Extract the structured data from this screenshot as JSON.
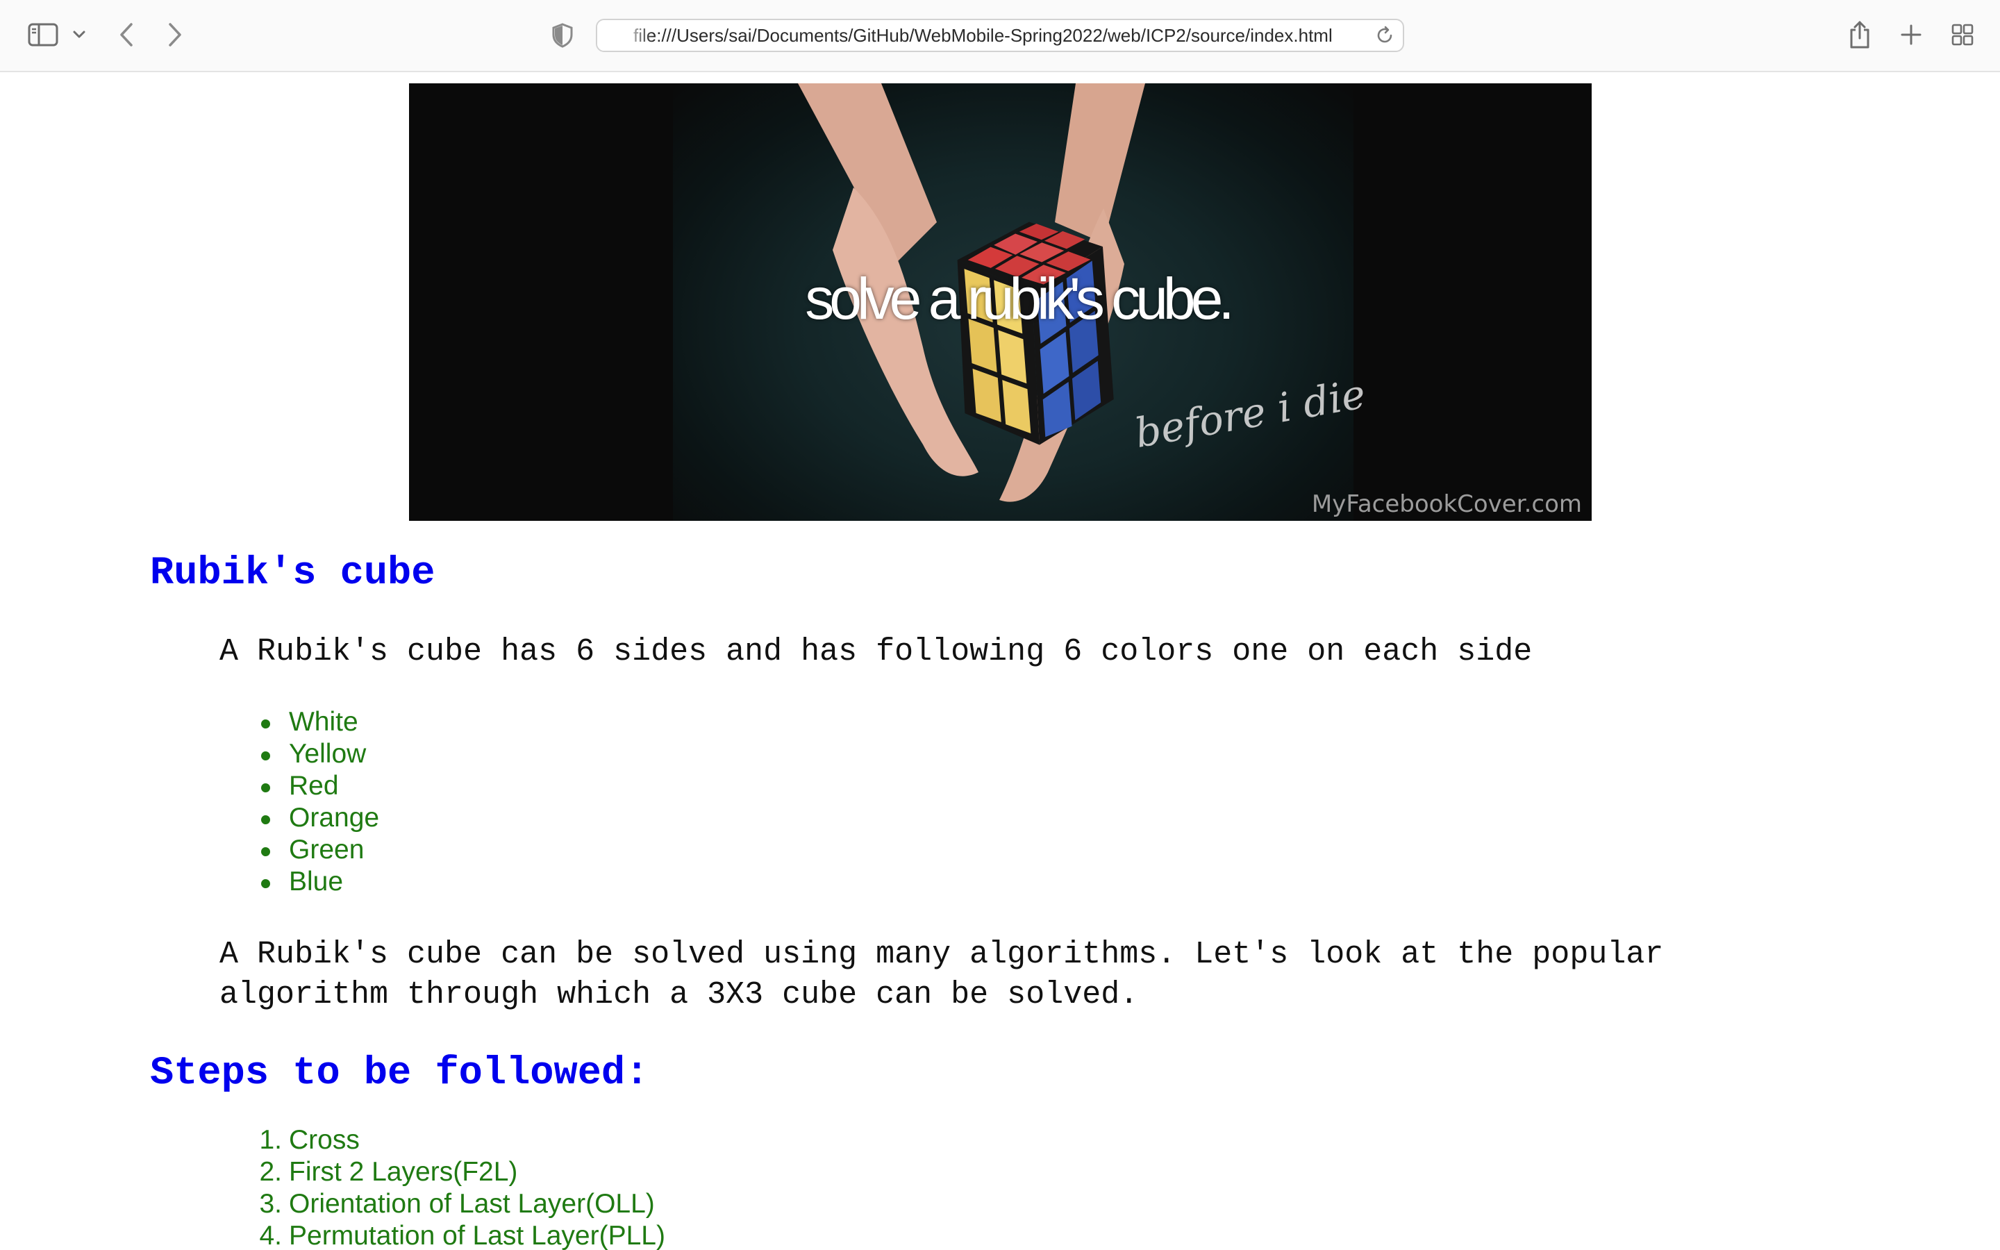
{
  "browser": {
    "url": "file:///Users/sai/Documents/GitHub/WebMobile-Spring2022/web/ICP2/source/index.html",
    "icons": {
      "sidebar": "sidebar-icon",
      "chevron": "chevron-down-icon",
      "back": "chevron-left-icon",
      "forward": "chevron-right-icon",
      "privacy": "shield-icon",
      "reload": "reload-icon",
      "share": "share-icon",
      "new_tab": "plus-icon",
      "tab_overview": "grid-icon"
    }
  },
  "banner": {
    "caption": "solve a rubik's cube.",
    "script": "before i die",
    "watermark": "MyFacebookCover.com"
  },
  "page": {
    "heading": "Rubik's cube",
    "intro": "A Rubik's cube has 6 sides and has following 6 colors one on each side",
    "colors": [
      "White",
      "Yellow",
      "Red",
      "Orange",
      "Green",
      "Blue"
    ],
    "algorithm_text_line1": "A Rubik's cube can be solved using many algorithms. Let's look at the popular",
    "algorithm_text_line2": "algorithm through which a 3X3 cube can be solved.",
    "steps_heading": "Steps to be followed:",
    "steps": [
      {
        "num": "1.",
        "label": "Cross"
      },
      {
        "num": "2.",
        "label": "First 2 Layers(F2L)"
      },
      {
        "num": "3.",
        "label": "Orientation of Last Layer(OLL)"
      },
      {
        "num": "4.",
        "label": "Permutation of Last Layer(PLL)"
      }
    ]
  },
  "colors_theme": {
    "heading": "#0000ee",
    "list": "#1f7a12",
    "body": "#111111"
  }
}
